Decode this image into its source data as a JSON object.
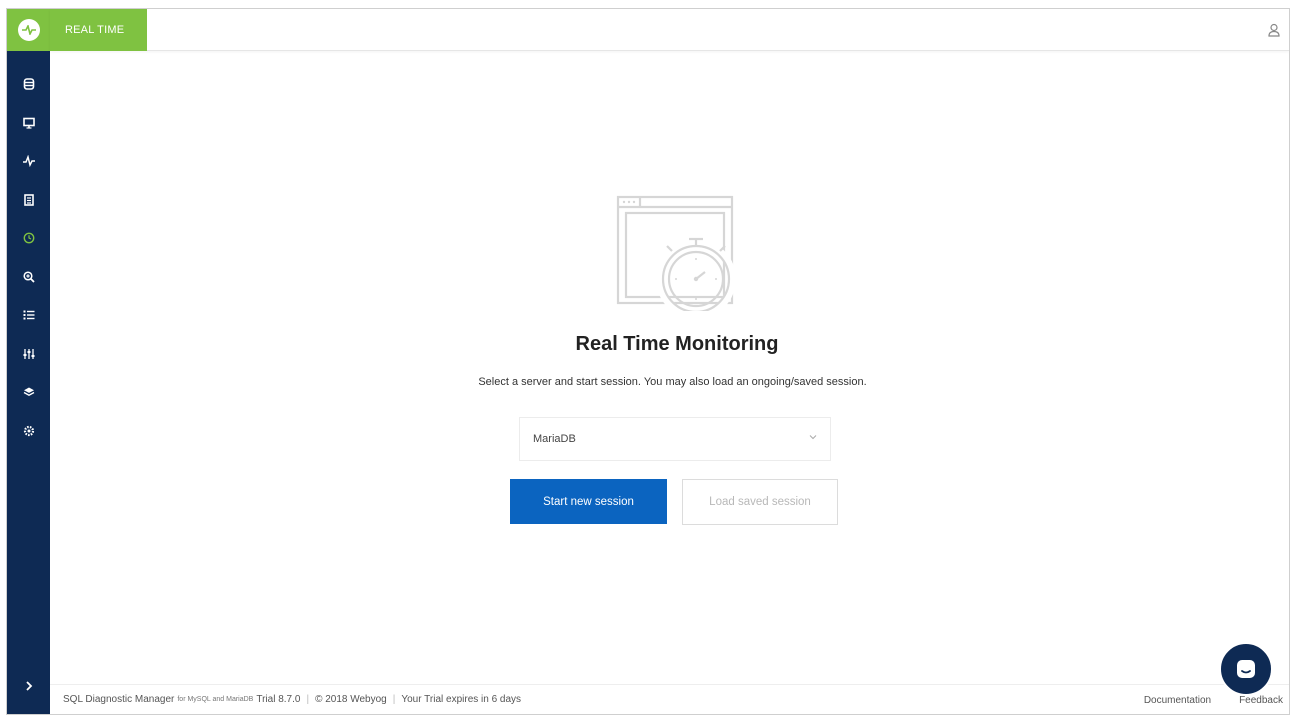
{
  "header": {
    "tab_label": "REAL TIME",
    "user_icon": "user-icon"
  },
  "sidebar": {
    "items": [
      {
        "icon": "database-icon"
      },
      {
        "icon": "monitor-icon"
      },
      {
        "icon": "activity-icon"
      },
      {
        "icon": "report-icon"
      },
      {
        "icon": "clock-icon",
        "active": true
      },
      {
        "icon": "zoom-in-icon"
      },
      {
        "icon": "list-icon"
      },
      {
        "icon": "sliders-icon"
      },
      {
        "icon": "layers-icon"
      },
      {
        "icon": "settings-icon"
      }
    ],
    "expand_icon": "chevron-right-icon"
  },
  "main": {
    "title": "Real Time Monitoring",
    "subtitle": "Select a server and start session. You may also load an ongoing/saved session.",
    "server_select": {
      "selected": "MariaDB"
    },
    "start_button": "Start new session",
    "load_button": "Load saved session"
  },
  "footer": {
    "product": "SQL Diagnostic Manager",
    "product_suffix": "for MySQL and MariaDB",
    "version": "Trial 8.7.0",
    "copyright": "© 2018 Webyog",
    "trial_notice": "Your Trial expires in 6 days",
    "documentation": "Documentation",
    "feedback": "Feedback"
  },
  "colors": {
    "sidebar_bg": "#0e2a54",
    "accent_green": "#7fc241",
    "primary_blue": "#0b64c0"
  }
}
